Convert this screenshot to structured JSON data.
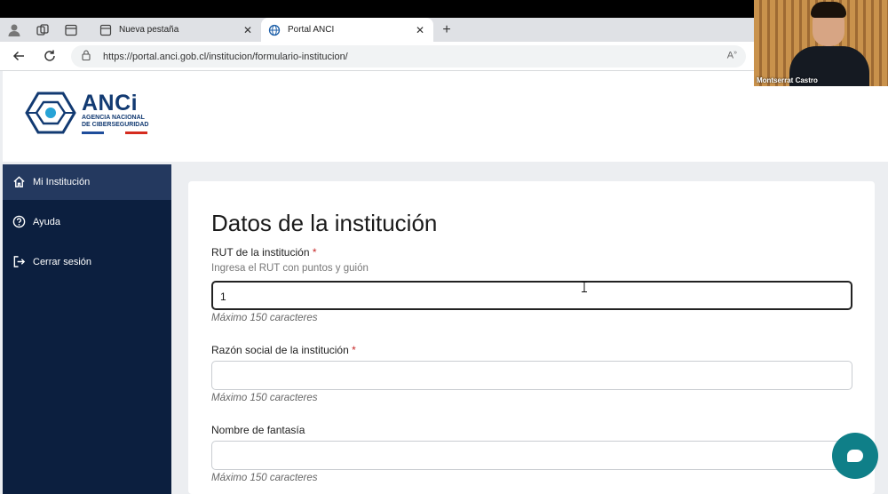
{
  "browser": {
    "tabs": [
      {
        "label": "Nueva pestaña",
        "icon": "page-icon"
      },
      {
        "label": "Portal ANCI",
        "icon": "globe-icon"
      }
    ],
    "tab_close_glyph": "✕",
    "new_tab_glyph": "+",
    "url": "https://portal.anci.gob.cl/institucion/formulario-institucion/"
  },
  "logo": {
    "title": "ANCi",
    "subtitle_line1": "AGENCIA NACIONAL",
    "subtitle_line2": "DE CIBERSEGURIDAD",
    "bar_colors": [
      "#1e4d9b",
      "#ffffff",
      "#d52b1e"
    ]
  },
  "sidebar": {
    "items": [
      {
        "label": "Mi Institución",
        "icon": "home-icon",
        "active": true
      },
      {
        "label": "Ayuda",
        "icon": "help-circle-icon",
        "active": false
      },
      {
        "label": "Cerrar sesión",
        "icon": "logout-icon",
        "active": false
      }
    ]
  },
  "form": {
    "title": "Datos de la institución",
    "fields": [
      {
        "label": "RUT de la institución",
        "required": "*",
        "hint": "Ingresa el RUT con puntos y guión",
        "value": "1",
        "max": "Máximo 150 caracteres"
      },
      {
        "label": "Razón social de la institución",
        "required": "*",
        "value": "",
        "max": "Máximo 150 caracteres"
      },
      {
        "label": "Nombre de fantasía",
        "required": "",
        "value": "",
        "max": "Máximo 150 caracteres"
      }
    ]
  },
  "video": {
    "participant": "Montserrat Castro"
  },
  "colors": {
    "sidebar_bg": "#0c1f3f",
    "sidebar_active": "#24395f",
    "brand_navy": "#123a72",
    "required_red": "#c62828",
    "chat_button": "#0f7f88"
  }
}
